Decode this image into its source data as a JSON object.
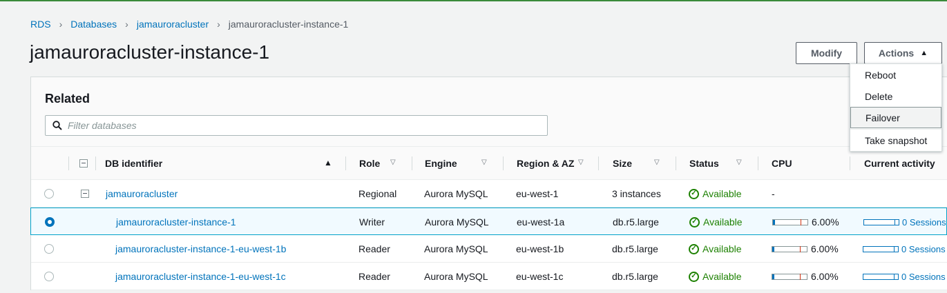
{
  "breadcrumb": [
    "RDS",
    "Databases",
    "jamauroracluster",
    "jamauroracluster-instance-1"
  ],
  "page_title": "jamauroracluster-instance-1",
  "buttons": {
    "modify": "Modify",
    "actions": "Actions"
  },
  "actions_menu": [
    "Reboot",
    "Delete",
    "Failover",
    "Take snapshot"
  ],
  "related": {
    "title": "Related",
    "filter_placeholder": "Filter databases",
    "columns": [
      "DB identifier",
      "Role",
      "Engine",
      "Region & AZ",
      "Size",
      "Status",
      "CPU",
      "Current activity"
    ],
    "rows": [
      {
        "id": "jamauroracluster",
        "role": "Regional",
        "engine": "Aurora MySQL",
        "region": "eu-west-1",
        "size": "3 instances",
        "status": "Available",
        "cpu": "-",
        "activity": "",
        "selected": false
      },
      {
        "id": "jamauroracluster-instance-1",
        "role": "Writer",
        "engine": "Aurora MySQL",
        "region": "eu-west-1a",
        "size": "db.r5.large",
        "status": "Available",
        "cpu": "6.00%",
        "activity": "0 Sessions",
        "selected": true
      },
      {
        "id": "jamauroracluster-instance-1-eu-west-1b",
        "role": "Reader",
        "engine": "Aurora MySQL",
        "region": "eu-west-1b",
        "size": "db.r5.large",
        "status": "Available",
        "cpu": "6.00%",
        "activity": "0 Sessions",
        "selected": false
      },
      {
        "id": "jamauroracluster-instance-1-eu-west-1c",
        "role": "Reader",
        "engine": "Aurora MySQL",
        "region": "eu-west-1c",
        "size": "db.r5.large",
        "status": "Available",
        "cpu": "6.00%",
        "activity": "0 Sessions",
        "selected": false
      }
    ]
  },
  "colors": {
    "link": "#0073bb",
    "status_available": "#1d8102",
    "selected_border": "#00a1c9"
  },
  "icons": {
    "breadcrumb_sep": "chevron-right-icon",
    "filter": "search-icon",
    "status": "check-circle-icon",
    "actions": "caret-up-icon"
  }
}
